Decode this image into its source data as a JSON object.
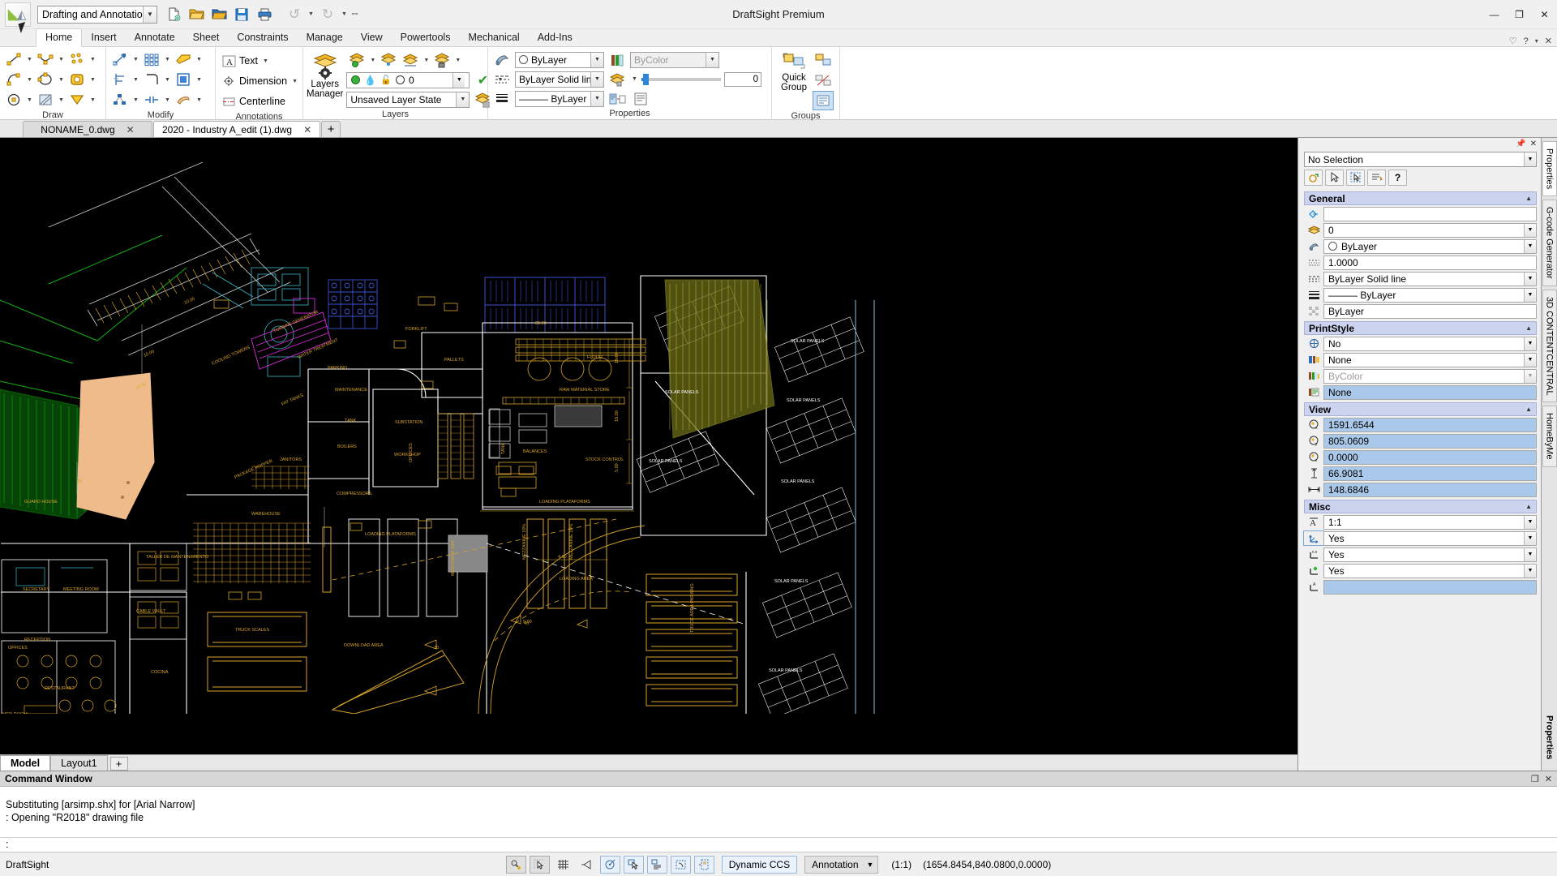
{
  "window": {
    "title": "DraftSight Premium",
    "workspace_value": "Drafting and Annotation",
    "minimize": "—",
    "maximize": "❐",
    "close": "✕"
  },
  "quick_access": [
    {
      "name": "new-file-icon",
      "glyph": "🗋"
    },
    {
      "name": "open-file-icon",
      "glyph": "📂"
    },
    {
      "name": "open-folder-icon",
      "glyph": "🗂"
    },
    {
      "name": "save-icon",
      "glyph": "💾"
    },
    {
      "name": "print-icon",
      "glyph": "🖶"
    },
    {
      "name": "undo-icon",
      "glyph": "↶"
    },
    {
      "name": "undo-dropdown-icon",
      "glyph": "▾"
    },
    {
      "name": "redo-icon",
      "glyph": "↷"
    },
    {
      "name": "redo-dropdown-icon",
      "glyph": "▾"
    },
    {
      "name": "customize-qat-icon",
      "glyph": "⩲"
    }
  ],
  "ribbon_tabs": [
    {
      "label": "Home",
      "active": true
    },
    {
      "label": "Insert",
      "active": false
    },
    {
      "label": "Annotate",
      "active": false
    },
    {
      "label": "Sheet",
      "active": false
    },
    {
      "label": "Constraints",
      "active": false
    },
    {
      "label": "Manage",
      "active": false
    },
    {
      "label": "View",
      "active": false
    },
    {
      "label": "Powertools",
      "active": false
    },
    {
      "label": "Mechanical",
      "active": false
    },
    {
      "label": "Add-Ins",
      "active": false
    }
  ],
  "tabbar_right": [
    {
      "name": "heart-icon",
      "glyph": "♡"
    },
    {
      "name": "help-icon",
      "glyph": "?"
    },
    {
      "name": "ribbon-options-icon",
      "glyph": "▾"
    },
    {
      "name": "ribbon-close-icon",
      "glyph": "✕"
    }
  ],
  "ribbon_groups": {
    "draw": {
      "label": "Draw",
      "rows": [
        [
          "line-icon",
          "spline-icon",
          "point-icon"
        ],
        [
          "arc-icon",
          "ellipse-icon",
          "polygon-icon"
        ],
        [
          "circle-icon",
          "hatch-icon",
          "solid-fill-icon"
        ]
      ]
    },
    "modify": {
      "label": "Modify",
      "rows": [
        [
          "move-icon",
          "rectangular-pattern-icon",
          "chamfer-icon"
        ],
        [
          "trim-icon",
          "fillet-icon",
          "offset-icon"
        ],
        [
          "explode-icon",
          "stretch-icon",
          "copy-icon"
        ]
      ]
    },
    "annotations": {
      "label": "Annotations",
      "items": [
        {
          "label": "Text",
          "icon": "text-icon",
          "caret": true
        },
        {
          "label": "Dimension",
          "icon": "dimension-icon",
          "caret": true
        },
        {
          "label": "Centerline",
          "icon": "centerline-icon",
          "caret": false
        }
      ]
    },
    "layers": {
      "label": "Layers",
      "manager_label": "Layers\nManager",
      "manager_line1": "Layers",
      "manager_line2": "Manager",
      "layer_current": "0",
      "layer_state": "Unsaved Layer State",
      "tool_icons": [
        "new-layer-icon",
        "freeze-layer-icon",
        "lock-layer-icon",
        "layer-isolate-icon",
        "layer-merge-icon",
        "layer-check-icon",
        "layer-previous-icon"
      ]
    },
    "properties": {
      "label": "Properties",
      "color_value": "ByLayer",
      "linestyle_value": "ByLayer      Solid line",
      "lineweight_value": "——— ByLayer",
      "printstyle_value": "ByColor",
      "transparency_value": "0"
    },
    "groups": {
      "label": "Groups",
      "quick_group_line1": "Quick",
      "quick_group_line2": "Group"
    }
  },
  "doc_tabs": [
    {
      "label": "NONAME_0.dwg",
      "active": false,
      "close": "✕"
    },
    {
      "label": "2020 - Industry A_edit (1).dwg",
      "active": true,
      "close": "✕"
    }
  ],
  "doc_tab_add": "+",
  "model_tabs": [
    {
      "label": "Model",
      "active": true
    },
    {
      "label": "Layout1",
      "active": false
    }
  ],
  "model_tab_add": "+",
  "properties_panel": {
    "header_pin": "📌",
    "header_close": "✕",
    "selection": "No Selection",
    "tools": [
      {
        "name": "quick-properties-icon",
        "glyph": "⟳"
      },
      {
        "name": "select-objects-icon",
        "glyph": "➤"
      },
      {
        "name": "quick-select-icon",
        "glyph": "⬚"
      },
      {
        "name": "list-properties-icon",
        "glyph": "☰"
      },
      {
        "name": "help-icon",
        "glyph": "?"
      }
    ],
    "sections": [
      {
        "title": "General",
        "collapse": "▲",
        "rows": [
          {
            "icon": "hyperlink-icon",
            "value": "",
            "dropdown": false,
            "highlight": false
          },
          {
            "icon": "layer-icon",
            "value": "0",
            "dropdown": true,
            "highlight": false
          },
          {
            "icon": "color-icon",
            "value": "ByLayer",
            "dropdown": true,
            "highlight": false,
            "swatch": "circle"
          },
          {
            "icon": "linescale-icon",
            "value": "1.0000",
            "dropdown": false,
            "highlight": false
          },
          {
            "icon": "linestyle-icon",
            "value": "ByLayer     Solid line",
            "dropdown": true,
            "highlight": false
          },
          {
            "icon": "lineweight-icon",
            "value": "——— ByLayer",
            "dropdown": true,
            "highlight": false
          },
          {
            "icon": "transparency-icon",
            "value": "ByLayer",
            "dropdown": false,
            "highlight": false
          }
        ]
      },
      {
        "title": "PrintStyle",
        "collapse": "▲",
        "rows": [
          {
            "icon": "print-toggle-icon",
            "value": "No",
            "dropdown": true,
            "highlight": false
          },
          {
            "icon": "printstyle-table-icon",
            "value": "None",
            "dropdown": true,
            "highlight": false
          },
          {
            "icon": "printstyle-name-icon",
            "value": "ByColor",
            "dropdown": true,
            "highlight": false,
            "dim": true
          },
          {
            "icon": "printstyle-sheet-icon",
            "value": "None",
            "dropdown": false,
            "highlight": true
          }
        ]
      },
      {
        "title": "View",
        "collapse": "▲",
        "rows": [
          {
            "icon": "center-x-icon",
            "value": "1591.6544",
            "dropdown": false,
            "highlight": true
          },
          {
            "icon": "center-y-icon",
            "value": "805.0609",
            "dropdown": false,
            "highlight": true
          },
          {
            "icon": "center-z-icon",
            "value": "0.0000",
            "dropdown": false,
            "highlight": true
          },
          {
            "icon": "view-height-icon",
            "value": "66.9081",
            "dropdown": false,
            "highlight": true
          },
          {
            "icon": "view-width-icon",
            "value": "148.6846",
            "dropdown": false,
            "highlight": true
          }
        ]
      },
      {
        "title": "Misc",
        "collapse": "▲",
        "rows": [
          {
            "icon": "annotation-scale-icon",
            "value": "1:1",
            "dropdown": true,
            "highlight": false
          },
          {
            "icon": "ccs-icon-toggle-icon",
            "value": "Yes",
            "dropdown": true,
            "highlight": false
          },
          {
            "icon": "ccs-origin-icon",
            "value": "Yes",
            "dropdown": true,
            "highlight": false
          },
          {
            "icon": "ccs-display-icon",
            "value": "Yes",
            "dropdown": true,
            "highlight": false
          },
          {
            "icon": "ccs-name-icon",
            "value": "",
            "dropdown": false,
            "highlight": true
          }
        ]
      }
    ],
    "side_tabs": [
      {
        "label": "Properties",
        "active": true
      },
      {
        "label": "G-code Generator",
        "active": false
      },
      {
        "label": "3D CONTENTCENTRAL",
        "active": false
      },
      {
        "label": "HomeByMe",
        "active": false
      }
    ],
    "side_tab_bottom": "Properties"
  },
  "command_window": {
    "title": "Command Window",
    "tools": [
      {
        "name": "restore-icon",
        "glyph": "❐"
      },
      {
        "name": "close-icon",
        "glyph": "✕"
      }
    ],
    "lines": [
      "Substituting [arsimp.shx] for [Arial Narrow]",
      ": Opening \"R2018\" drawing file"
    ],
    "prompt": ":"
  },
  "status_bar": {
    "app_name": "DraftSight",
    "buttons": [
      {
        "name": "entity-snap-icon",
        "glyph": "🔑",
        "state": "press"
      },
      {
        "name": "snap-mode-icon",
        "glyph": "➤",
        "state": "press"
      },
      {
        "name": "grid-icon",
        "glyph": "▦",
        "state": "off"
      },
      {
        "name": "ortho-icon",
        "glyph": "◁",
        "state": "off"
      },
      {
        "name": "polar-guides-icon",
        "glyph": "◷",
        "state": "on"
      },
      {
        "name": "entity-snaps-icon",
        "glyph": "⊾",
        "state": "on"
      },
      {
        "name": "entity-tracking-icon",
        "glyph": "☰",
        "state": "on"
      },
      {
        "name": "lineweight-display-icon",
        "glyph": "⬚",
        "state": "on"
      },
      {
        "name": "dynamic-input-icon",
        "glyph": "⌸",
        "state": "on"
      }
    ],
    "dynamic_ccs": "Dynamic CCS",
    "annotation_dropdown": "Annotation",
    "annotation_caret": "▼",
    "scale": "(1:1)",
    "coordinates": "(1654.8454,840.0800,0.0000)"
  },
  "colors": {
    "canvas_bg": "#000000",
    "cad_yellow": "#d8a42a",
    "cad_white": "#ffffff",
    "cad_green": "#12b012",
    "cad_cyan": "#38b8c8",
    "cad_magenta": "#d92ad9",
    "cad_blue": "#3a50d0",
    "cad_orange": "#e8a060",
    "accent": "#1a7fd4",
    "panel_bg": "#f0f0f0",
    "section_head": "#ccd3ef",
    "highlight_field": "#aac9ea"
  }
}
